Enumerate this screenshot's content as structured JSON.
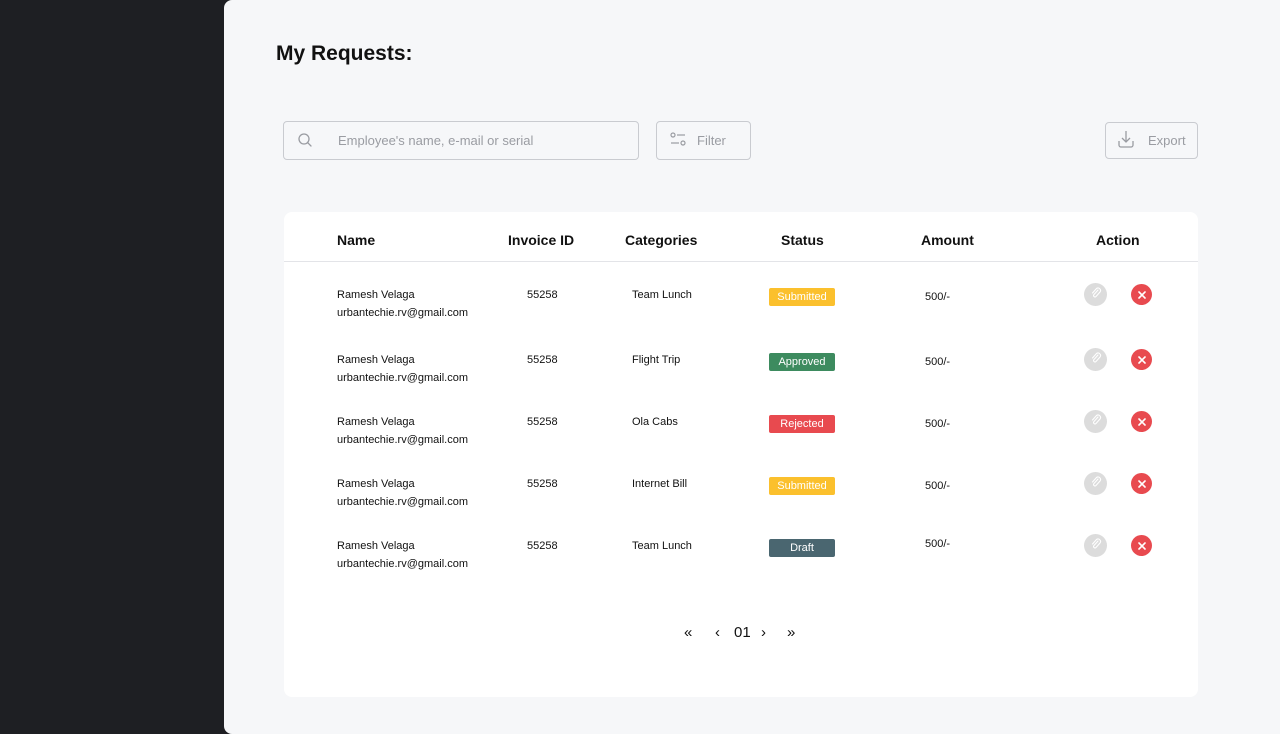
{
  "page": {
    "title": "My Requests:"
  },
  "search": {
    "placeholder": "Employee's name, e-mail or serial"
  },
  "toolbar": {
    "filter_label": "Filter",
    "export_label": "Export"
  },
  "table": {
    "headers": [
      "Name",
      "Invoice ID",
      "Categories",
      "Status",
      "Amount",
      "Action"
    ],
    "rows": [
      {
        "name": "Ramesh Velaga",
        "email": "urbantechie.rv@gmail.com",
        "invoice": "55258",
        "category": "Team Lunch",
        "status": "Submitted",
        "amount": "500/-"
      },
      {
        "name": "Ramesh Velaga",
        "email": "urbantechie.rv@gmail.com",
        "invoice": "55258",
        "category": "Flight Trip",
        "status": "Approved",
        "amount": "500/-"
      },
      {
        "name": "Ramesh Velaga",
        "email": "urbantechie.rv@gmail.com",
        "invoice": "55258",
        "category": "Ola Cabs",
        "status": "Rejected",
        "amount": "500/-"
      },
      {
        "name": "Ramesh Velaga",
        "email": "urbantechie.rv@gmail.com",
        "invoice": "55258",
        "category": "Internet Bill",
        "status": "Submitted",
        "amount": "500/-"
      },
      {
        "name": "Ramesh Velaga",
        "email": "urbantechie.rv@gmail.com",
        "invoice": "55258",
        "category": "Team Lunch",
        "status": "Draft",
        "amount": "500/-"
      }
    ]
  },
  "status_colors": {
    "Submitted": "#fbc02d",
    "Approved": "#3d8b5f",
    "Rejected": "#e84a4f",
    "Draft": "#4a6670"
  },
  "pagination": {
    "first": "«",
    "prev": "‹",
    "current": "01",
    "next": "›",
    "last": "»"
  },
  "icons": {
    "search": "search-icon",
    "filter": "sliders-icon",
    "export": "download-icon",
    "edit": "paperclip-icon",
    "delete": "close-icon"
  }
}
